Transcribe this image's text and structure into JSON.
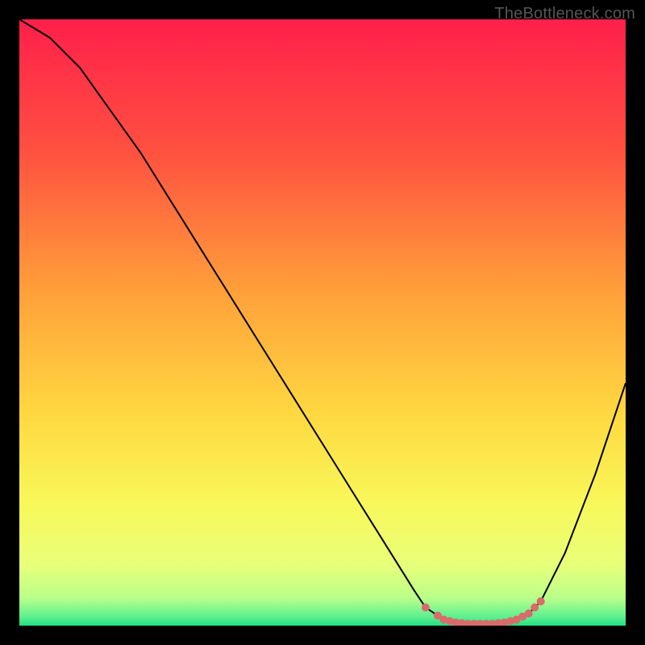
{
  "watermark": "TheBottleneck.com",
  "chart_data": {
    "type": "line",
    "title": "",
    "xlabel": "",
    "ylabel": "",
    "xlim": [
      0,
      100
    ],
    "ylim": [
      0,
      100
    ],
    "x": [
      0,
      5,
      10,
      15,
      20,
      25,
      30,
      35,
      40,
      45,
      50,
      55,
      60,
      65,
      67,
      70,
      72,
      74,
      76,
      78,
      80,
      82,
      84,
      86,
      90,
      95,
      100
    ],
    "values": [
      100,
      97,
      92,
      85,
      78,
      70,
      62,
      54,
      46,
      38,
      30,
      22,
      14,
      6,
      3,
      1,
      0.5,
      0.3,
      0.3,
      0.3,
      0.5,
      1,
      2,
      4,
      12,
      25,
      40
    ],
    "highlight_points": {
      "x": [
        67,
        69,
        70,
        71,
        72,
        73,
        74,
        75,
        76,
        77,
        78,
        79,
        80,
        81,
        82,
        83,
        84,
        85,
        86
      ],
      "color": "#d96b6b"
    },
    "gradient_stops": [
      {
        "offset": 0,
        "color": "#ff1f4b"
      },
      {
        "offset": 0.22,
        "color": "#ff5140"
      },
      {
        "offset": 0.45,
        "color": "#ffa03a"
      },
      {
        "offset": 0.65,
        "color": "#ffd840"
      },
      {
        "offset": 0.8,
        "color": "#f8f85a"
      },
      {
        "offset": 0.9,
        "color": "#e8ff7a"
      },
      {
        "offset": 0.955,
        "color": "#b8ff8a"
      },
      {
        "offset": 0.985,
        "color": "#60f090"
      },
      {
        "offset": 1.0,
        "color": "#20e080"
      }
    ]
  }
}
